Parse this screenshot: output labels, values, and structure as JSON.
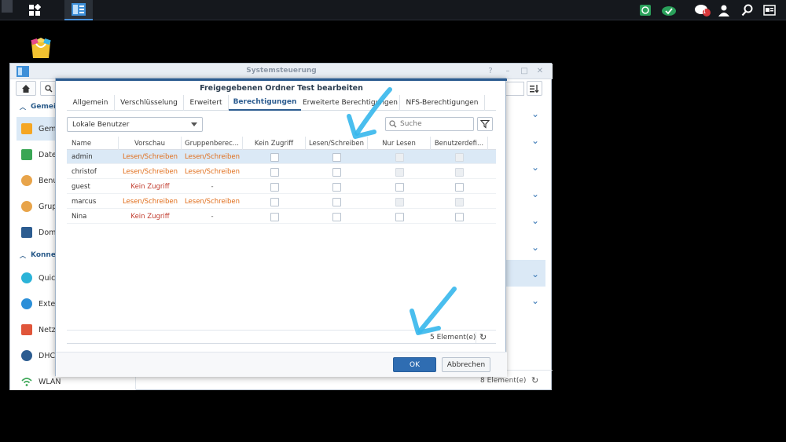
{
  "taskbar": {
    "notification_badge": "1"
  },
  "sysctl": {
    "title": "Systemsteuerung",
    "sidebar": {
      "categories": [
        "Gemein",
        "Konnek"
      ],
      "items": [
        {
          "label": "Geme",
          "icon": "share-icon",
          "color": "#f5a623"
        },
        {
          "label": "Datei",
          "icon": "file-services-icon",
          "color": "#3aa655"
        },
        {
          "label": "Benut",
          "icon": "user-icon",
          "color": "#e8a44a"
        },
        {
          "label": "Grupp",
          "icon": "group-icon",
          "color": "#e8a44a"
        },
        {
          "label": "Doma",
          "icon": "domain-icon",
          "color": "#2c5c90"
        },
        {
          "label": "Quick",
          "icon": "quickconnect-icon",
          "color": "#2bb3d8"
        },
        {
          "label": "Exter",
          "icon": "external-access-icon",
          "color": "#2c8fd8"
        },
        {
          "label": "Netzv",
          "icon": "network-icon",
          "color": "#e0553a"
        },
        {
          "label": "DHCP",
          "icon": "dhcp-icon",
          "color": "#2c5c90"
        },
        {
          "label": "WLAN",
          "icon": "wifi-icon",
          "color": "#3aa655"
        }
      ]
    },
    "footer_count": "8 Element(e)"
  },
  "dialog": {
    "title": "Freigegebenen Ordner Test bearbeiten",
    "tabs": [
      "Allgemein",
      "Verschlüsselung",
      "Erweitert",
      "Berechtigungen",
      "Erweiterte Berechtigungen",
      "NFS-Berechtigungen"
    ],
    "active_tab": "Berechtigungen",
    "user_select": "Lokale Benutzer",
    "search_placeholder": "Suche",
    "columns": [
      "Name",
      "Vorschau",
      "Gruppenberec...",
      "Kein Zugriff",
      "Lesen/Schreiben",
      "Nur Lesen",
      "Benutzerdefi..."
    ],
    "rows": [
      {
        "name": "admin",
        "preview": "Lesen/Schreiben",
        "group": "Lesen/Schreiben",
        "selected": true
      },
      {
        "name": "christof",
        "preview": "Lesen/Schreiben",
        "group": "Lesen/Schreiben",
        "selected": false
      },
      {
        "name": "guest",
        "preview": "Kein Zugriff",
        "group": "-",
        "selected": false
      },
      {
        "name": "marcus",
        "preview": "Lesen/Schreiben",
        "group": "Lesen/Schreiben",
        "selected": false
      },
      {
        "name": "Nina",
        "preview": "Kein Zugriff",
        "group": "-",
        "selected": false
      }
    ],
    "count": "5 Element(e)",
    "ok_label": "OK",
    "cancel_label": "Abbrechen"
  },
  "colors": {
    "accent": "#2c5c90",
    "read_write": "#e06d1a",
    "no_access": "#c0392b",
    "annotation": "#36b7ec"
  }
}
